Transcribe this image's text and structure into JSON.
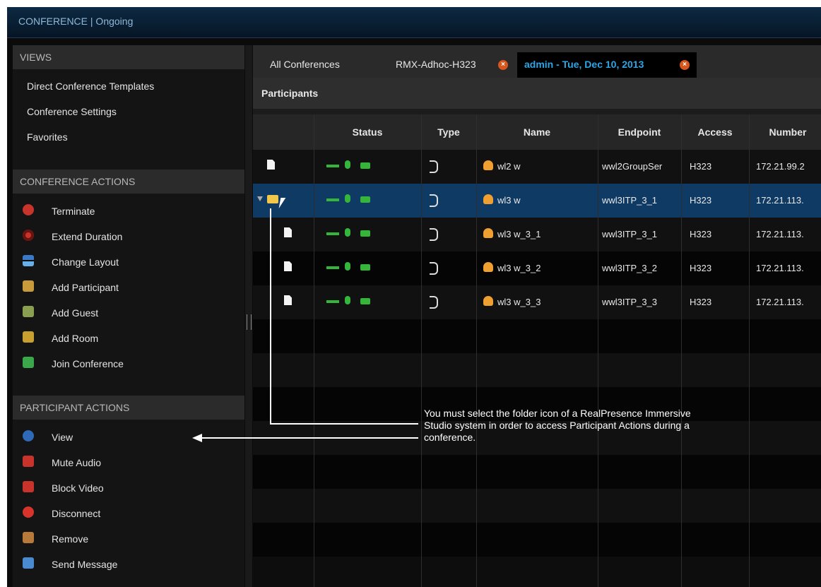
{
  "window": {
    "title": "CONFERENCE | Ongoing"
  },
  "views": {
    "heading": "VIEWS",
    "items": [
      {
        "label": "Direct Conference Templates"
      },
      {
        "label": "Conference Settings"
      },
      {
        "label": "Favorites"
      }
    ]
  },
  "conference_actions": {
    "heading": "CONFERENCE ACTIONS",
    "items": [
      {
        "label": "Terminate",
        "icon": "terminate-icon"
      },
      {
        "label": "Extend Duration",
        "icon": "extend-duration-icon"
      },
      {
        "label": "Change Layout",
        "icon": "layout-icon"
      },
      {
        "label": "Add Participant",
        "icon": "add-participant-icon"
      },
      {
        "label": "Add Guest",
        "icon": "add-guest-icon"
      },
      {
        "label": "Add Room",
        "icon": "add-room-icon"
      },
      {
        "label": "Join Conference",
        "icon": "join-conference-icon"
      }
    ]
  },
  "participant_actions": {
    "heading": "PARTICIPANT ACTIONS",
    "items": [
      {
        "label": "View",
        "icon": "view-icon"
      },
      {
        "label": "Mute Audio",
        "icon": "mute-audio-icon"
      },
      {
        "label": "Block Video",
        "icon": "block-video-icon"
      },
      {
        "label": "Disconnect",
        "icon": "disconnect-icon"
      },
      {
        "label": "Remove",
        "icon": "remove-icon"
      },
      {
        "label": "Send Message",
        "icon": "send-message-icon"
      }
    ]
  },
  "tabs": [
    {
      "label": "All Conferences",
      "closable": false
    },
    {
      "label": "RMX-Adhoc-H323",
      "closable": true
    },
    {
      "label": "admin - Tue, Dec 10, 2013",
      "closable": true,
      "active": true
    }
  ],
  "participants": {
    "heading": "Participants",
    "columns": [
      "",
      "Status",
      "Type",
      "Name",
      "Endpoint",
      "Access",
      "Number"
    ],
    "rows": [
      {
        "name": "wl2 w",
        "endpoint": "wwl2GroupSer",
        "access": "H323",
        "number": "172.21.99.2",
        "folder": false,
        "selected": false,
        "child": false
      },
      {
        "name": "wl3 w",
        "endpoint": "wwl3ITP_3_1",
        "access": "H323",
        "number": "172.21.113.",
        "folder": true,
        "selected": true,
        "child": false
      },
      {
        "name": "wl3 w_3_1",
        "endpoint": "wwl3ITP_3_1",
        "access": "H323",
        "number": "172.21.113.",
        "folder": false,
        "selected": false,
        "child": true
      },
      {
        "name": "wl3 w_3_2",
        "endpoint": "wwl3ITP_3_2",
        "access": "H323",
        "number": "172.21.113.",
        "folder": false,
        "selected": false,
        "child": true
      },
      {
        "name": "wl3 w_3_3",
        "endpoint": "wwl3ITP_3_3",
        "access": "H323",
        "number": "172.21.113.",
        "folder": false,
        "selected": false,
        "child": true
      }
    ]
  },
  "callout": {
    "text": "You must select the folder icon of a RealPresence Immersive Studio system in order to access Participant Actions during a conference."
  },
  "colors": {
    "status_green": "#35b53a",
    "selected_row": "#0f3a63",
    "accent_blue": "#2ca6e6",
    "close_orange": "#d9551e"
  }
}
